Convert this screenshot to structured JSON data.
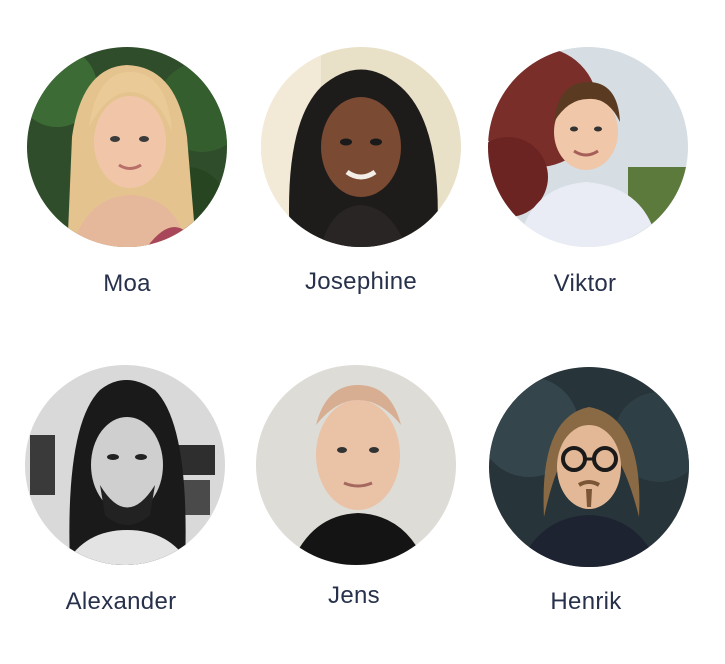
{
  "team": {
    "members": [
      {
        "name": "Moa"
      },
      {
        "name": "Josephine"
      },
      {
        "name": "Viktor"
      },
      {
        "name": "Alexander"
      },
      {
        "name": "Jens"
      },
      {
        "name": "Henrik"
      }
    ]
  },
  "colors": {
    "name_text": "#27314b",
    "background": "#ffffff"
  }
}
